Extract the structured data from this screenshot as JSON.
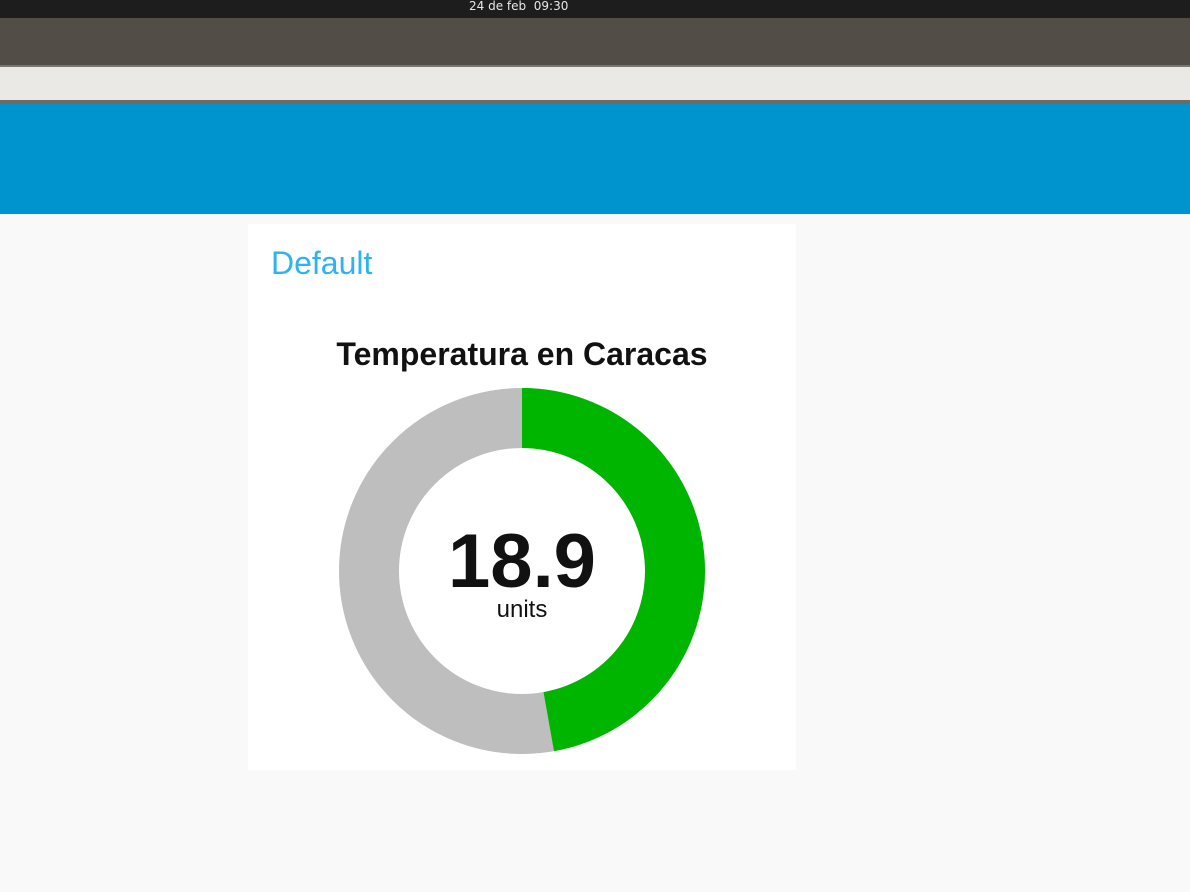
{
  "system_bar": {
    "clock": "24 de feb  09:30"
  },
  "dashboard": {
    "group_title": "Default",
    "gauge": {
      "title": "Temperatura en Caracas",
      "value_text": "18.9",
      "units": "units",
      "fill_fraction": 0.472,
      "fill_color": "#00b500",
      "track_color": "#bebebe"
    }
  }
}
